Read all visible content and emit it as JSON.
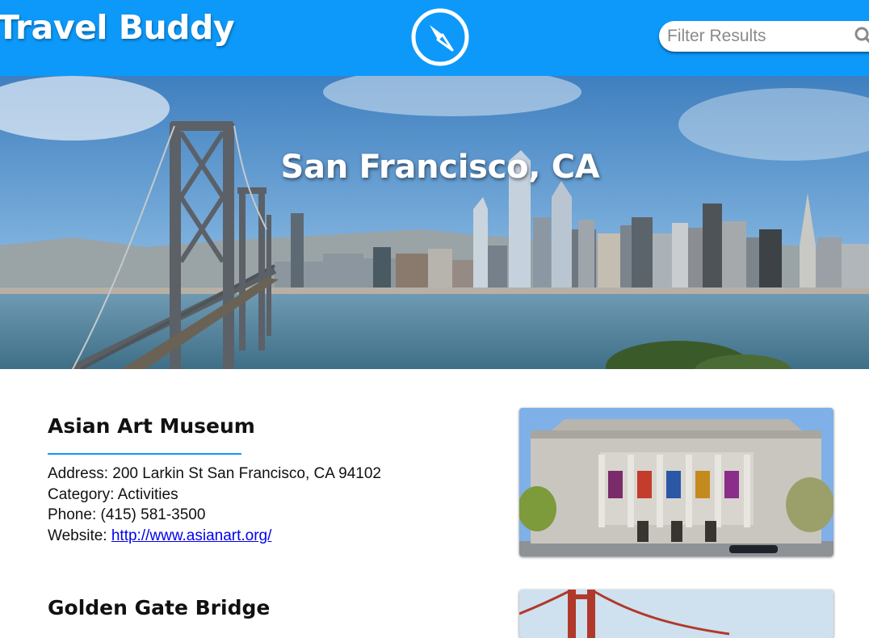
{
  "header": {
    "app_title": "Travel Buddy",
    "logo_icon": "compass-icon",
    "search": {
      "placeholder": "Filter Results",
      "value": "",
      "icon": "search-icon"
    },
    "color": "#0d99fa"
  },
  "hero": {
    "city": "San Francisco, CA"
  },
  "listings": [
    {
      "name": "Asian Art Museum",
      "address_label": "Address:",
      "address": "200 Larkin St San Francisco, CA 94102",
      "category_label": "Category:",
      "category": "Activities",
      "phone_label": "Phone:",
      "phone": "(415) 581-3500",
      "website_label": "Website:",
      "website": "http://www.asianart.org/"
    },
    {
      "name": "Golden Gate Bridge"
    }
  ]
}
